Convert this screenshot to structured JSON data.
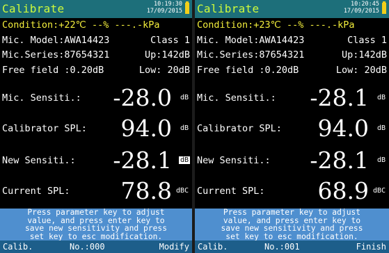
{
  "screens": [
    {
      "title": "Calibrate",
      "time": "10:19:30",
      "date": "17/09/2015",
      "condition": "Condition:+22℃  --%  ---.-kPa",
      "mic_model": "Mic. Model:AWA14423",
      "mic_class": "Class 1",
      "mic_series": "Mic.Series:87654321",
      "up": "Up:142dB",
      "free_field": "Free field  :0.20dB",
      "low": "Low: 20dB",
      "mic_sensitivity_label": "Mic. Sensiti.:",
      "mic_sensitivity_value": "-28.0",
      "mic_sensitivity_unit": "dB",
      "calibrator_spl_label": "Calibrator SPL:",
      "calibrator_spl_value": "94.0",
      "calibrator_spl_unit": "dB",
      "new_sensitivity_label": "New Sensiti.:",
      "new_sensitivity_value": "-28.1",
      "new_sensitivity_unit": "dB",
      "current_spl_label": "Current  SPL:",
      "current_spl_value": "78.8",
      "current_spl_unit": "dBC",
      "help_lines": [
        "Press parameter key to adjust",
        "value, and press enter key to",
        "save new sensitivity and press",
        "set key to esc modification."
      ],
      "bottom_left": "Calib.",
      "bottom_middle": "No.:000",
      "bottom_right": "Modify"
    },
    {
      "title": "Calibrate",
      "time": "10:20:45",
      "date": "17/09/2015",
      "condition": "Condition:+23℃  --%  ---.-kPa",
      "mic_model": "Mic. Model:AWA14423",
      "mic_class": "Class 1",
      "mic_series": "Mic.Series:87654321",
      "up": "Up:142dB",
      "free_field": "Free field  :0.20dB",
      "low": "Low: 20dB",
      "mic_sensitivity_label": "Mic. Sensiti.:",
      "mic_sensitivity_value": "-28.1",
      "mic_sensitivity_unit": "dB",
      "calibrator_spl_label": "Calibrator SPL:",
      "calibrator_spl_value": "94.0",
      "calibrator_spl_unit": "dB",
      "new_sensitivity_label": "New Sensiti.:",
      "new_sensitivity_value": "-28.1",
      "new_sensitivity_unit": "dB",
      "current_spl_label": "Current  SPL:",
      "current_spl_value": "68.9",
      "current_spl_unit": "dBC",
      "help_lines": [
        "Press parameter key to adjust",
        "value, and press enter key to",
        "save new sensitivity and press",
        "set key to esc modification."
      ],
      "bottom_left": "Calib.",
      "bottom_middle": "No.:001",
      "bottom_right": "Finish"
    }
  ],
  "colors": {
    "title_bar": "#1d6f7a",
    "title_text": "#cdfa3c",
    "condition_text": "#f3ee3c",
    "help_background": "#4f8fcf",
    "bottom_bar": "#1d5e8a",
    "battery": "#f2cf1a"
  },
  "icons": [
    "battery-icon"
  ]
}
